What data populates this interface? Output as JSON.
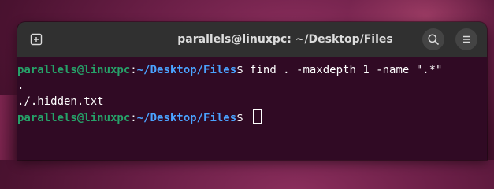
{
  "window": {
    "title": "parallels@linuxpc: ~/Desktop/Files"
  },
  "headerbar": {
    "new_tab_icon": "new-tab-icon",
    "search_icon": "search-icon",
    "menu_icon": "hamburger-menu-icon"
  },
  "terminal": {
    "user_host": "parallels@linuxpc",
    "colon": ":",
    "path": "~/Desktop/Files",
    "prompt_symbol": "$ ",
    "command": "find . -maxdepth 1 -name \".*\"",
    "output": [
      ".",
      "./.hidden.txt"
    ]
  },
  "colors": {
    "terminal_bg": "#300a24",
    "user_host": "#26a269",
    "path": "#4aa3ff",
    "headerbar": "#303030"
  }
}
